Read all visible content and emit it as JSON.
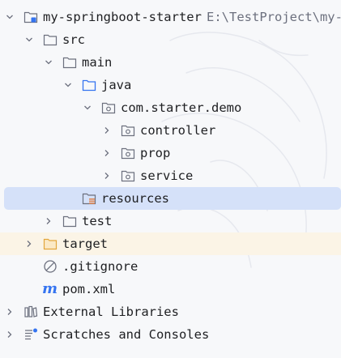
{
  "project_tree": {
    "root": {
      "label": "my-springboot-starter",
      "path": "E:\\TestProject\\my-s"
    },
    "src": {
      "label": "src"
    },
    "main": {
      "label": "main"
    },
    "java": {
      "label": "java"
    },
    "package": {
      "label": "com.starter.demo"
    },
    "controller": {
      "label": "controller"
    },
    "prop": {
      "label": "prop"
    },
    "service": {
      "label": "service"
    },
    "resources": {
      "label": "resources"
    },
    "test": {
      "label": "test"
    },
    "target": {
      "label": "target"
    },
    "gitignore": {
      "label": ".gitignore"
    },
    "pom": {
      "label": "pom.xml"
    },
    "external_libraries": {
      "label": "External Libraries"
    },
    "scratches": {
      "label": "Scratches and Consoles"
    }
  },
  "colors": {
    "background": "#f7f8fa",
    "selected_row": "#d5e1f9",
    "excluded_row": "#fbf4e6",
    "folder_icon": "#6c707e",
    "source_folder_icon": "#3574f0",
    "excluded_folder_icon": "#e3a63c",
    "maven_icon": "#3574f0",
    "path_text": "#6c707e"
  }
}
